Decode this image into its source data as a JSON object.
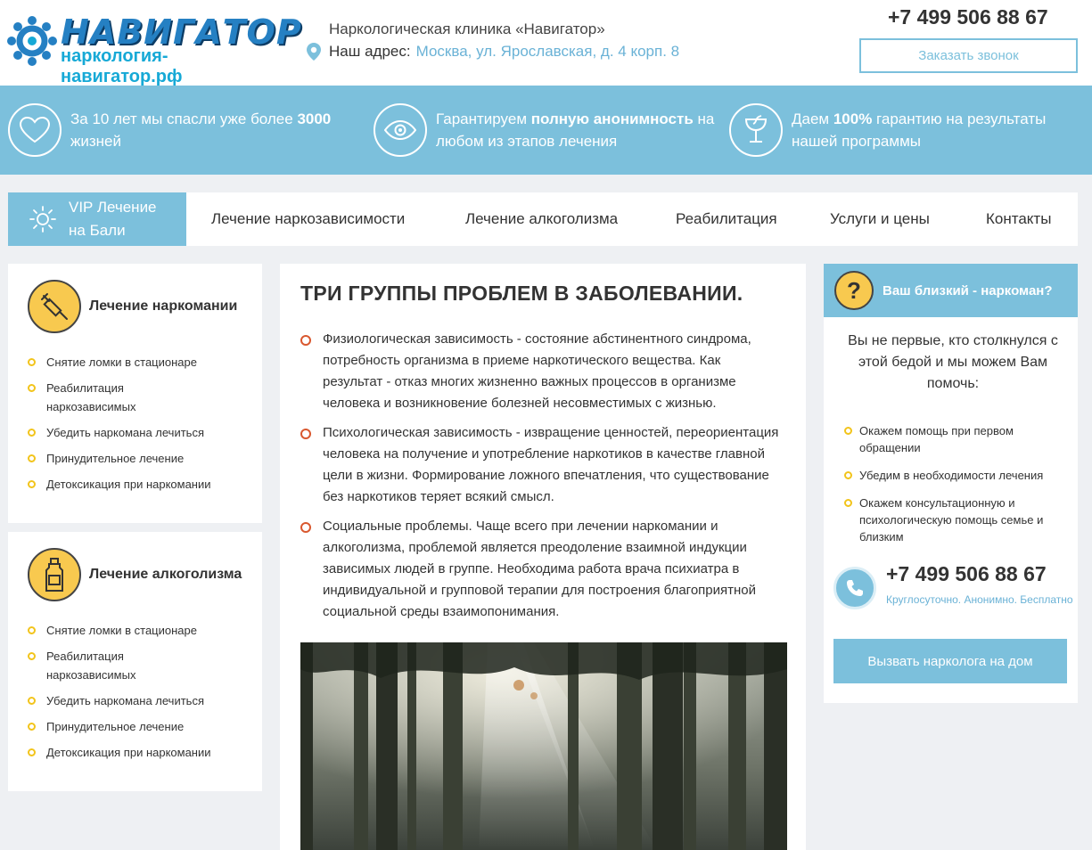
{
  "header": {
    "logo_title": "НАВИГАТОР",
    "logo_sub": "наркология-навигатор.рф",
    "clinic_name": "Наркологическая клиника «Навигатор»",
    "address_label": "Наш адрес:",
    "address_value": "Москва, ул. Ярославская, д. 4 корп. 8",
    "phone": "+7 499 506 88 67",
    "callback_label": "Заказать звонок"
  },
  "features": [
    {
      "icon": "heart-icon",
      "pre": "За 10 лет мы спасли уже более ",
      "bold": "3000",
      "post": " жизней"
    },
    {
      "icon": "eye-icon",
      "pre": "Гарантируем ",
      "bold": "полную анонимность",
      "post": " на любом из этапов лечения"
    },
    {
      "icon": "pharmacy-cup-icon",
      "pre": "Даем ",
      "bold": "100%",
      "post": " гарантию на результаты нашей программы"
    }
  ],
  "nav": {
    "vip_line1": "VIP Лечение",
    "vip_line2": "на Бали",
    "items": [
      "Лечение наркозависимости",
      "Лечение алкоголизма",
      "Реабилитация",
      "Услуги и цены",
      "Контакты"
    ]
  },
  "left_cards": [
    {
      "icon": "syringe-icon",
      "title": "Лечение наркомании",
      "items": [
        "Снятие ломки в стационаре",
        "Реабилитация наркозависимых",
        "Убедить наркомана лечиться",
        "Принудительное лечение",
        "Детоксикация при наркомании"
      ]
    },
    {
      "icon": "bottle-icon",
      "title": "Лечение алкоголизма",
      "items": [
        "Снятие ломки в стационаре",
        "Реабилитация наркозависимых",
        "Убедить наркомана лечиться",
        "Принудительное лечение",
        "Детоксикация при наркомании"
      ]
    }
  ],
  "main": {
    "title": "ТРИ ГРУППЫ ПРОБЛЕМ В ЗАБОЛЕВАНИИ.",
    "items": [
      "Физиологическая зависимость - состояние абстинентного синдрома, потребность организма в приеме наркотического вещества. Как результат - отказ многих жизненно важных процессов в организме человека и возникновение болезней несовместимых с жизнью.",
      "Психологическая зависимость - извращение ценностей, переориентация человека на получение и употребление наркотиков в качестве главной цели в жизни. Формирование ложного впечатления, что существование без наркотиков теряет всякий смысл.",
      "Социальные проблемы. Чаще всего при лечении наркомании и алкоголизма, проблемой является преодоление взаимной индукции зависимых людей в группе. Необходима работа врача психиатра в индивидуальной и групповой терапии для построения благоприятной социальной среды взаимопонимания."
    ]
  },
  "right": {
    "question_mark": "?",
    "title": "Ваш близкий - наркоман?",
    "intro": "Вы не первые, кто столкнулся с этой бедой и мы можем Вам помочь:",
    "items": [
      "Окажем помощь при первом обращении",
      "Убедим в необходимости лечения",
      "Окажем консультационную и психологическую помощь семье и близким"
    ],
    "phone": "+7 499 506 88 67",
    "phone_note": "Круглосуточно. Анонимно. Бесплатно",
    "call_button": "Вызвать нарколога на дом"
  }
}
